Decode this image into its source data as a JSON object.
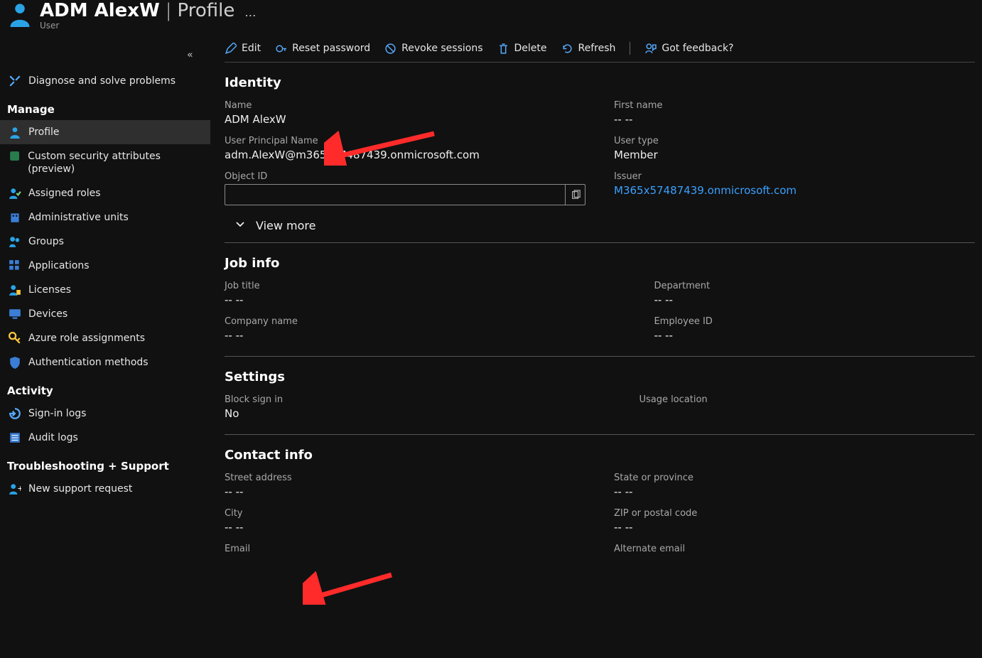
{
  "header": {
    "user_name": "ADM AlexW",
    "sep": "|",
    "page": "Profile",
    "sub_type": "User",
    "more_label": "…"
  },
  "sidebar": {
    "diag_label": "Diagnose and solve problems",
    "section_manage": "Manage",
    "section_activity": "Activity",
    "section_trouble": "Troubleshooting + Support",
    "profile": "Profile",
    "custom_sec": "Custom security attributes (preview)",
    "assigned_roles": "Assigned roles",
    "admin_units": "Administrative units",
    "groups": "Groups",
    "applications": "Applications",
    "licenses": "Licenses",
    "devices": "Devices",
    "role_assign": "Azure role assignments",
    "auth_methods": "Authentication methods",
    "signin_logs": "Sign-in logs",
    "audit_logs": "Audit logs",
    "new_support": "New support request"
  },
  "toolbar": {
    "edit": "Edit",
    "reset": "Reset password",
    "revoke": "Revoke sessions",
    "delete": "Delete",
    "refresh": "Refresh",
    "feedback": "Got feedback?"
  },
  "sections": {
    "identity": "Identity",
    "viewmore": "View more",
    "jobinfo": "Job info",
    "settings": "Settings",
    "contact": "Contact info"
  },
  "identity": {
    "name_l": "Name",
    "name_v": "ADM AlexW",
    "first_l": "First name",
    "first_v": "-- --",
    "upn_l": "User Principal Name",
    "upn_v": "adm.AlexW@m365x57487439.onmicrosoft.com",
    "usertype_l": "User type",
    "usertype_v": "Member",
    "objid_l": "Object ID",
    "objid_v": "",
    "issuer_l": "Issuer",
    "issuer_v": "M365x57487439.onmicrosoft.com"
  },
  "job": {
    "title_l": "Job title",
    "title_v": "-- --",
    "dept_l": "Department",
    "dept_v": "-- --",
    "company_l": "Company name",
    "company_v": "-- --",
    "empid_l": "Employee ID",
    "empid_v": "-- --"
  },
  "settings_s": {
    "block_l": "Block sign in",
    "block_v": "No",
    "usage_l": "Usage location",
    "usage_v": ""
  },
  "contact": {
    "street_l": "Street address",
    "street_v": "-- --",
    "state_l": "State or province",
    "state_v": "-- --",
    "city_l": "City",
    "city_v": "-- --",
    "zip_l": "ZIP or postal code",
    "zip_v": "-- --",
    "email_l": "Email",
    "email_v": "",
    "alt_l": "Alternate email",
    "alt_v": ""
  }
}
